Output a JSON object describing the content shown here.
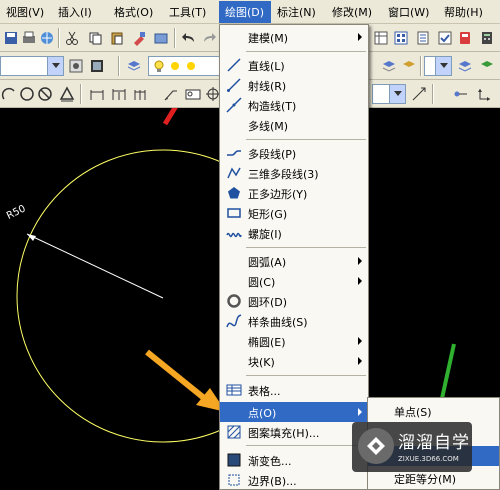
{
  "menubar": {
    "items": [
      {
        "label": "视图(V)"
      },
      {
        "label": "插入(I)"
      },
      {
        "label": "格式(O)"
      },
      {
        "label": "工具(T)"
      },
      {
        "label": "绘图(D)"
      },
      {
        "label": "标注(N)"
      },
      {
        "label": "修改(M)"
      },
      {
        "label": "窗口(W)"
      },
      {
        "label": "帮助(H)"
      }
    ]
  },
  "drawing": {
    "dimension_label": "R50",
    "circle_color": "#ffff66"
  },
  "draw_menu": {
    "items": [
      {
        "label": "建模(M)",
        "icon": "none",
        "submenu": true
      },
      {
        "label": "直线(L)",
        "icon": "line-icon"
      },
      {
        "label": "射线(R)",
        "icon": "ray-icon"
      },
      {
        "label": "构造线(T)",
        "icon": "construction-line-icon"
      },
      {
        "label": "多线(M)",
        "icon": "none"
      },
      {
        "label": "多段线(P)",
        "icon": "polyline-icon"
      },
      {
        "label": "三维多段线(3)",
        "icon": "3d-polyline-icon"
      },
      {
        "label": "正多边形(Y)",
        "icon": "polygon-icon"
      },
      {
        "label": "矩形(G)",
        "icon": "rectangle-icon"
      },
      {
        "label": "螺旋(I)",
        "icon": "helix-icon"
      },
      {
        "label": "圆弧(A)",
        "icon": "none",
        "submenu": true
      },
      {
        "label": "圆(C)",
        "icon": "none",
        "submenu": true
      },
      {
        "label": "圆环(D)",
        "icon": "donut-icon"
      },
      {
        "label": "样条曲线(S)",
        "icon": "spline-icon"
      },
      {
        "label": "椭圆(E)",
        "icon": "none",
        "submenu": true
      },
      {
        "label": "块(K)",
        "icon": "none",
        "submenu": true
      },
      {
        "label": "表格...",
        "icon": "table-icon"
      },
      {
        "label": "点(O)",
        "icon": "none",
        "submenu": true
      },
      {
        "label": "图案填充(H)...",
        "icon": "hatch-icon"
      },
      {
        "label": "渐变色...",
        "icon": "gradient-icon"
      },
      {
        "label": "边界(B)...",
        "icon": "boundary-icon"
      }
    ]
  },
  "point_submenu": {
    "items": [
      {
        "label": "单点(S)"
      },
      {
        "label": ""
      },
      {
        "label": ""
      },
      {
        "label": "定距等分(M)"
      }
    ]
  },
  "watermark": {
    "title": "溜溜自学",
    "subtitle": "ZIXUE.3D66.COM"
  },
  "colors": {
    "menu_highlight": "#316ac5",
    "toolbar_bg": "#ece9d8",
    "arrow_red": "#e02020",
    "arrow_orange": "#f5a623",
    "arrow_green": "#2fb02f"
  }
}
